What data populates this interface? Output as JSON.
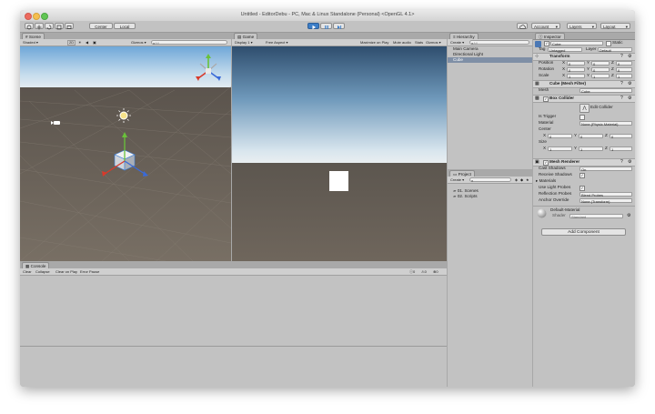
{
  "window": {
    "title": "Untitled - EditorDebu - PC, Mac & Linux Standalone (Personal) <OpenGL 4.1>"
  },
  "toolbar": {
    "pivot_label": "Center",
    "space_label": "Local",
    "account_label": "Account",
    "layers_label": "Layers",
    "layout_label": "Layout"
  },
  "scene": {
    "tab": "Scene",
    "shading": "Shaded",
    "mode_2d": "2D",
    "gizmos": "Gizmos",
    "search_placeholder": "All"
  },
  "game": {
    "tab": "Game",
    "display": "Display 1",
    "aspect": "Free Aspect",
    "maximize": "Maximize on Play",
    "mute": "Mute audio",
    "stats": "Stats",
    "gizmos": "Gizmos"
  },
  "hierarchy": {
    "tab": "Hierarchy",
    "create": "Create",
    "search_placeholder": "All",
    "items": [
      "Main Camera",
      "Directional Light",
      "Cube"
    ],
    "selected_index": 2
  },
  "project": {
    "tab": "Project",
    "create": "Create",
    "folders": [
      "01. Scenes",
      "02. Scripts"
    ]
  },
  "console": {
    "tab": "Console",
    "buttons": [
      "Clear",
      "Collapse",
      "Clear on Play",
      "Error Pause"
    ],
    "counts": [
      "0",
      "0",
      "0"
    ]
  },
  "inspector": {
    "tab": "Inspector",
    "object_name": "Cube",
    "static_label": "Static",
    "tag_label": "Tag",
    "tag_value": "Untagged",
    "layer_label": "Layer",
    "layer_value": "Default",
    "transform": {
      "title": "Transform",
      "rows": [
        {
          "label": "Position",
          "x": "0",
          "y": "0",
          "z": "0"
        },
        {
          "label": "Rotation",
          "x": "0",
          "y": "0",
          "z": "0"
        },
        {
          "label": "Scale",
          "x": "1",
          "y": "1",
          "z": "1"
        }
      ]
    },
    "mesh_filter": {
      "title": "Cube (Mesh Filter)",
      "mesh_label": "Mesh",
      "mesh_value": "Cube"
    },
    "box_collider": {
      "title": "Box Collider",
      "edit_label": "Edit Collider",
      "is_trigger": "Is Trigger",
      "material_label": "Material",
      "material_value": "None (Physic Material)",
      "center_label": "Center",
      "center": {
        "x": "0",
        "y": "0",
        "z": "0"
      },
      "size_label": "Size",
      "size": {
        "x": "1",
        "y": "1",
        "z": "1"
      }
    },
    "mesh_renderer": {
      "title": "Mesh Renderer",
      "cast_shadows": "Cast Shadows",
      "cast_value": "On",
      "receive_shadows": "Receive Shadows",
      "materials": "Materials",
      "use_light_probes": "Use Light Probes",
      "reflection_probes": "Reflection Probes",
      "reflection_value": "Blend Probes",
      "anchor_override": "Anchor Override",
      "anchor_value": "None (Transform)"
    },
    "material": {
      "name": "Default-Material",
      "shader_label": "Shader",
      "shader_value": "Standard"
    },
    "add_component": "Add Component"
  },
  "colors": {
    "sky_top": "#b9d8ee",
    "ground": "#6f665c",
    "selection": "#3d7ed8"
  }
}
